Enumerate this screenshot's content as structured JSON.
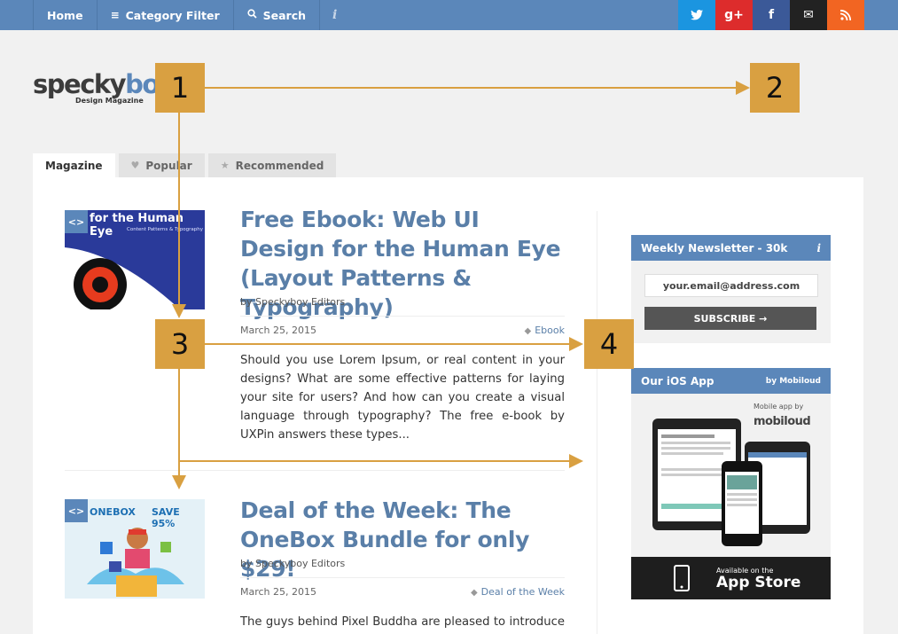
{
  "nav": {
    "home": "Home",
    "category_filter": "Category Filter",
    "search": "Search",
    "info": "i",
    "icons": {
      "category": "menu-icon",
      "search": "search-icon"
    }
  },
  "social": [
    {
      "name": "twitter",
      "glyph": "t",
      "color": "#1b95e0"
    },
    {
      "name": "google-plus",
      "glyph": "g+",
      "color": "#dd2c2c"
    },
    {
      "name": "facebook",
      "glyph": "f",
      "color": "#3b5998"
    },
    {
      "name": "email",
      "glyph": "✉",
      "color": "#222222"
    },
    {
      "name": "rss",
      "glyph": "◉",
      "color": "#f26522"
    }
  ],
  "logo": {
    "main_a": "specky",
    "main_b": "boy",
    "sub": "Design Magazine"
  },
  "tabs": [
    {
      "label": "Magazine",
      "icon": ""
    },
    {
      "label": "Popular",
      "icon": "heart-icon"
    },
    {
      "label": "Recommended",
      "icon": "star-icon"
    }
  ],
  "posts": [
    {
      "thumb_text": "for the Human Eye",
      "thumb_sub": "Content Patterns & Typography",
      "title": "Free Ebook: Web UI Design for the Human Eye (Layout Patterns & Typography)",
      "byline": "by Speckyboy Editors",
      "date": "March 25, 2015",
      "tag": "Ebook",
      "excerpt": "Should you use Lorem Ipsum, or real content in your designs? What are some effective patterns for laying your site for users? And how can you create a visual language through typography? The free e-book by UXPin answers these types..."
    },
    {
      "thumb_text": "ONEBOX",
      "thumb_save": "SAVE 95%",
      "title": "Deal of the Week: The OneBox Bundle for only $29!",
      "byline": "by Speckyboy Editors",
      "date": "March 25, 2015",
      "tag": "Deal of the Week",
      "excerpt": "The guys behind Pixel Buddha are pleased to introduce a"
    }
  ],
  "sidebar": {
    "newsletter_title": "Weekly Newsletter - 30k",
    "newsletter_info": "i",
    "email_placeholder": "your.email@address.com",
    "subscribe_label": "SUBSCRIBE →",
    "app_title": "Our iOS App",
    "app_by": "by Mobiloud",
    "mobile_app_by": "Mobile app by",
    "mobiloud": "mobiloud",
    "appstore_small": "Available on the",
    "appstore_big": "App Store"
  },
  "annotations": [
    "1",
    "2",
    "3",
    "4"
  ],
  "colors": {
    "accent": "#5b87ba",
    "annotation": "#d9a041"
  }
}
